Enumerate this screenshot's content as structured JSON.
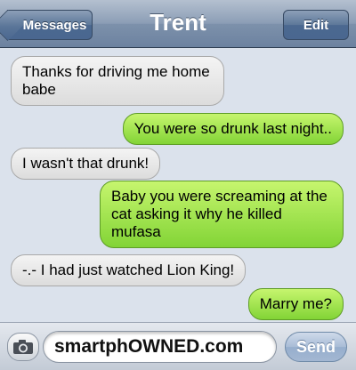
{
  "navbar": {
    "title": "Trent",
    "back_label": "Messages",
    "edit_label": "Edit"
  },
  "messages": [
    {
      "direction": "incoming",
      "text": "Thanks for driving me home babe"
    },
    {
      "direction": "outgoing",
      "text": "You were so drunk last night.."
    },
    {
      "direction": "incoming",
      "text": "I wasn't that drunk!"
    },
    {
      "direction": "outgoing",
      "text": "Baby you were screaming at the cat asking it why he killed mufasa"
    },
    {
      "direction": "incoming",
      "text": "-.- I had just watched Lion King!"
    },
    {
      "direction": "outgoing",
      "text": "Marry me?"
    }
  ],
  "composer": {
    "camera_icon": "camera-icon",
    "input_value": "smartphOWNED.com",
    "send_label": "Send"
  },
  "colors": {
    "outgoing_bubble": "#8fd93f",
    "incoming_bubble": "#e6e6e6",
    "navbar": "#7d91ab"
  }
}
